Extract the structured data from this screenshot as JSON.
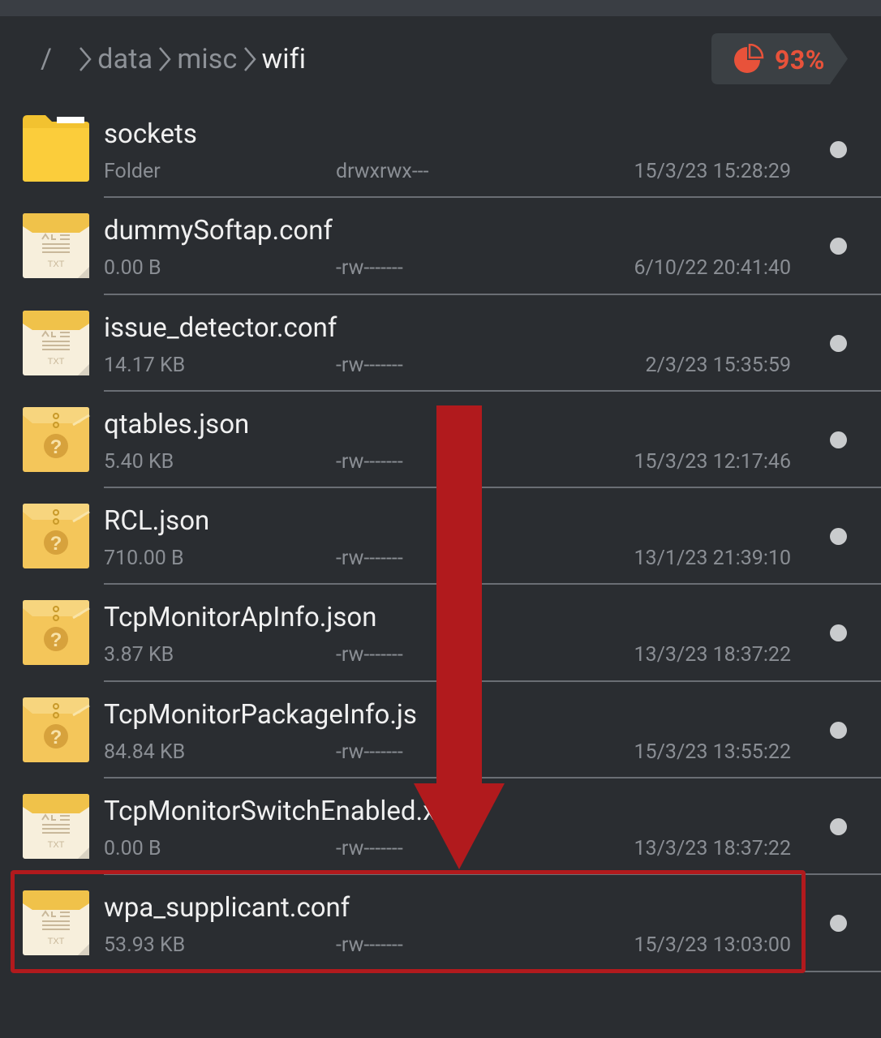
{
  "breadcrumb": {
    "root": "/",
    "segments": [
      "data",
      "misc",
      "wifi"
    ]
  },
  "storage": {
    "percent_label": "93%",
    "usage_fraction": 0.93,
    "accent_color": "#e8523a"
  },
  "files": [
    {
      "name": "sockets",
      "size": "Folder",
      "perms": "drwxrwx---",
      "date": "15/3/23 15:28:29",
      "icon": "folder-icon"
    },
    {
      "name": "dummySoftap.conf",
      "size": "0.00 B",
      "perms": "-rw-------",
      "date": "6/10/22 20:41:40",
      "icon": "text-file-icon"
    },
    {
      "name": "issue_detector.conf",
      "size": "14.17 KB",
      "perms": "-rw-------",
      "date": "2/3/23 15:35:59",
      "icon": "text-file-icon"
    },
    {
      "name": "qtables.json",
      "size": "5.40 KB",
      "perms": "-rw-------",
      "date": "15/3/23 12:17:46",
      "icon": "unknown-file-icon"
    },
    {
      "name": "RCL.json",
      "size": "710.00 B",
      "perms": "-rw-------",
      "date": "13/1/23 21:39:10",
      "icon": "unknown-file-icon"
    },
    {
      "name": "TcpMonitorApInfo.json",
      "size": "3.87 KB",
      "perms": "-rw-------",
      "date": "13/3/23 18:37:22",
      "icon": "unknown-file-icon"
    },
    {
      "name": "TcpMonitorPackageInfo.js",
      "size": "84.84 KB",
      "perms": "-rw-------",
      "date": "15/3/23 13:55:22",
      "icon": "unknown-file-icon"
    },
    {
      "name": "TcpMonitorSwitchEnabled.xml",
      "size": "0.00 B",
      "perms": "-rw-------",
      "date": "13/3/23 18:37:22",
      "icon": "text-file-icon"
    },
    {
      "name": "wpa_supplicant.conf",
      "size": "53.93 KB",
      "perms": "-rw-------",
      "date": "15/3/23 13:03:00",
      "icon": "text-file-icon"
    }
  ],
  "annotation": {
    "highlight_color": "#b11a1d",
    "highlighted_file": "wpa_supplicant.conf"
  }
}
